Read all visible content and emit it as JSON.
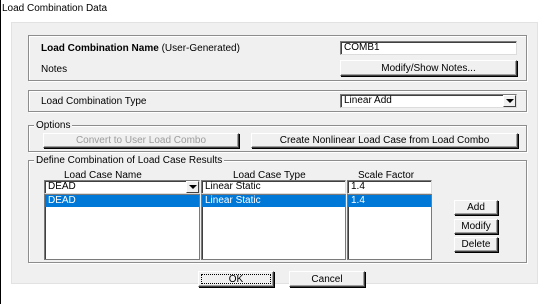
{
  "title": "Load Combination Data",
  "name_label_bold": "Load Combination Name",
  "name_label_suffix": " (User-Generated)",
  "name_value": "COMB1",
  "notes_label": "Notes",
  "notes_button": "Modify/Show Notes...",
  "type_label": "Load Combination Type",
  "type_value": "Linear Add",
  "options_legend": "Options",
  "convert_button": "Convert to User Load Combo",
  "nonlinear_button": "Create Nonlinear Load Case from Load Combo",
  "define_legend": "Define Combination of Load Case Results",
  "col_headers": {
    "name": "Load Case Name",
    "type": "Load Case Type",
    "scale": "Scale Factor"
  },
  "edit_row": {
    "name": "DEAD",
    "type": "Linear Static",
    "scale": "1.4"
  },
  "rows": [
    {
      "name": "DEAD",
      "type": "Linear Static",
      "scale": "1.4"
    }
  ],
  "add_button": "Add",
  "modify_button": "Modify",
  "delete_button": "Delete",
  "ok_button": "OK",
  "cancel_button": "Cancel",
  "colors": {
    "selection": "#0078d7",
    "face": "#f0f0f0"
  },
  "icons": [
    "chevron-down-icon"
  ]
}
